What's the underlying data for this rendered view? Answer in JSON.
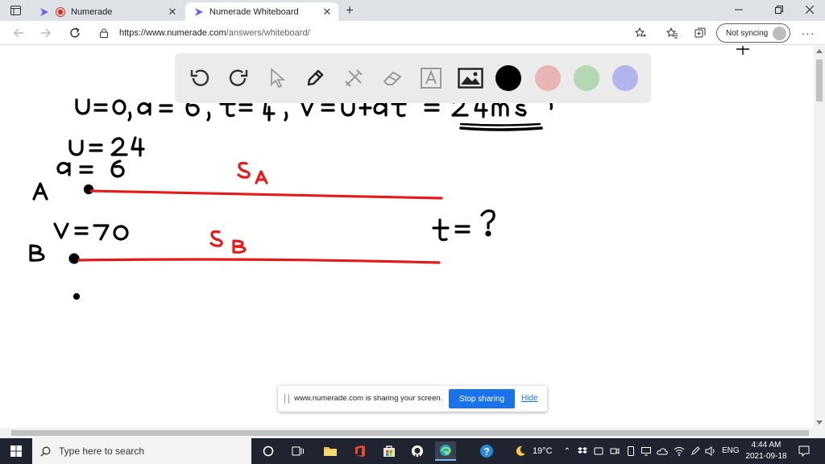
{
  "browser": {
    "tabs": [
      {
        "title": "Numerade",
        "active": false
      },
      {
        "title": "Numerade Whiteboard",
        "active": true
      }
    ],
    "url_host": "https://www.numerade.com",
    "url_path": "/answers/whiteboard/",
    "sync_label": "Not syncing"
  },
  "whiteboard": {
    "tools": [
      "undo-icon",
      "redo-icon",
      "pointer-icon",
      "pen-icon",
      "tools-icon",
      "eraser-icon",
      "text-icon",
      "image-icon"
    ],
    "colors": [
      "#000000",
      "#e8b4b4",
      "#b4d8b4",
      "#b4b4ec"
    ],
    "ink_black": "#000000",
    "ink_red": "#e31b1b"
  },
  "share_banner": {
    "message": "www.numerade.com is sharing your screen.",
    "stop_label": "Stop sharing",
    "hide_label": "Hide"
  },
  "taskbar": {
    "search_placeholder": "Type here to search",
    "temperature": "19°C",
    "language": "ENG",
    "time": "4:44 AM",
    "date": "2021-09-18"
  }
}
